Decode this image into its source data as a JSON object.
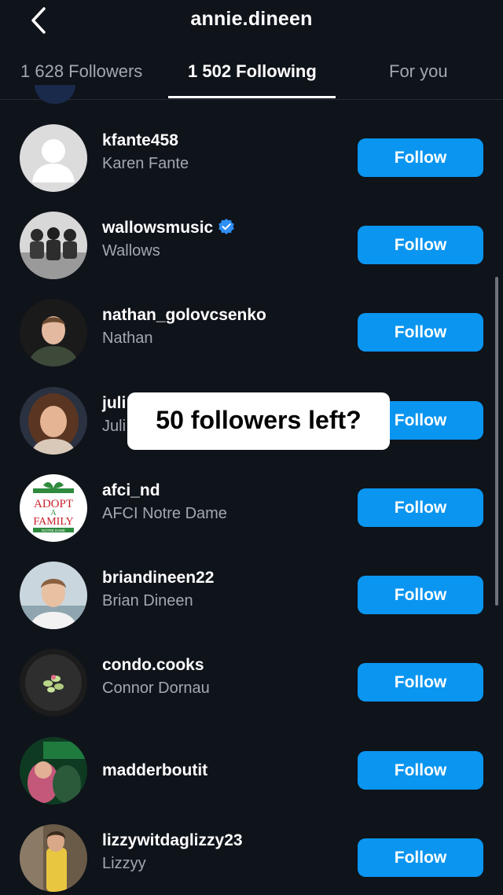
{
  "header": {
    "title": "annie.dineen",
    "back_icon": "chevron-left-icon"
  },
  "tabs": [
    {
      "label": "1 628 Followers",
      "active": false
    },
    {
      "label": "1 502 Following",
      "active": true
    },
    {
      "label": "For you",
      "active": false
    }
  ],
  "users": [
    {
      "username": "kfante458",
      "name": "Karen Fante",
      "verified": false,
      "button": "Follow"
    },
    {
      "username": "wallowsmusic",
      "name": "Wallows",
      "verified": true,
      "button": "Follow"
    },
    {
      "username": "nathan_golovcsenko",
      "name": "Nathan",
      "verified": false,
      "button": "Follow"
    },
    {
      "username": "juli",
      "name": "Juli",
      "verified": false,
      "button": "Follow"
    },
    {
      "username": "afci_nd",
      "name": "AFCI Notre Dame",
      "verified": false,
      "button": "Follow"
    },
    {
      "username": "briandineen22",
      "name": "Brian Dineen",
      "verified": false,
      "button": "Follow"
    },
    {
      "username": "condo.cooks",
      "name": "Connor Dornau",
      "verified": false,
      "button": "Follow"
    },
    {
      "username": "madderboutit",
      "name": "",
      "verified": false,
      "button": "Follow"
    },
    {
      "username": "lizzywitdaglizzy23",
      "name": "Lizzyy",
      "verified": false,
      "button": "Follow"
    }
  ],
  "overlay": {
    "text": "50 followers left?"
  },
  "avatar_logo": {
    "line1": "ADOPT",
    "line2": "A",
    "line3": "FAMILY",
    "line4": "NOTRE DAME"
  },
  "colors": {
    "background": "#0f131a",
    "follow_button": "#0a95f0",
    "secondary_text": "#a3a8b0",
    "verified_badge": "#2f8ff5"
  }
}
